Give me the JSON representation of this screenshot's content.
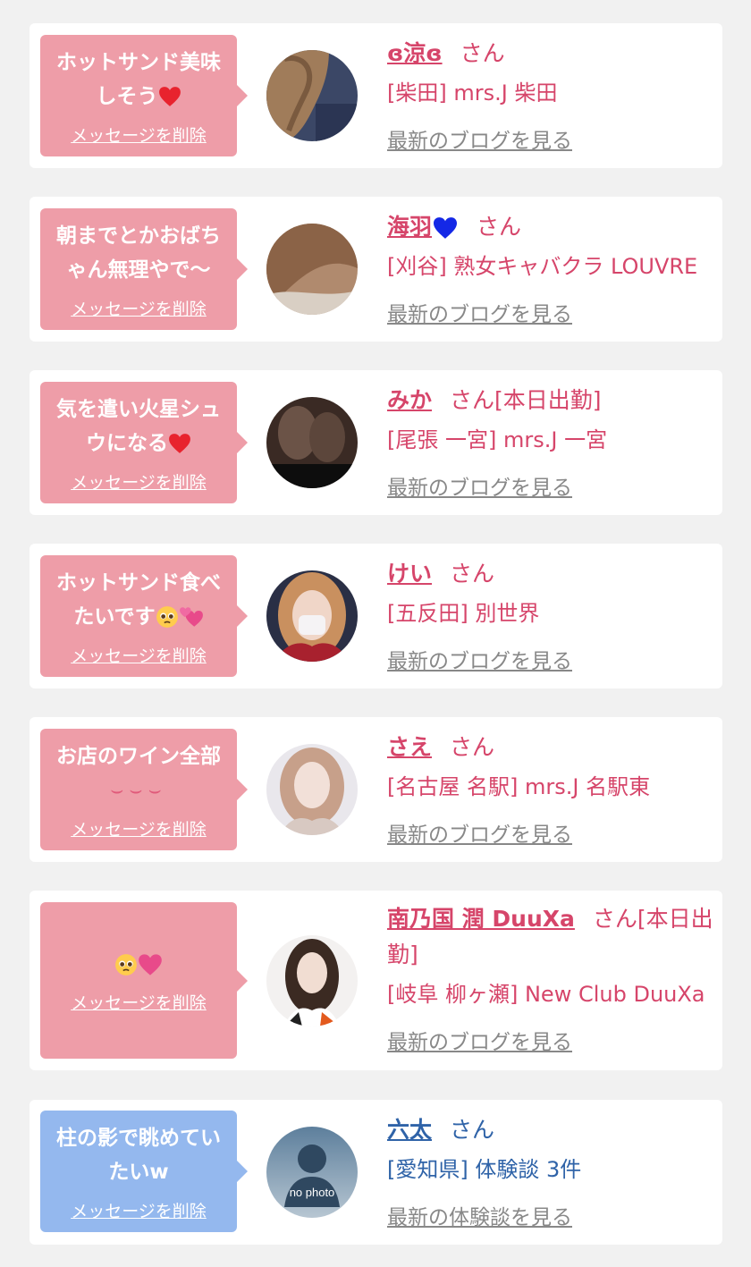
{
  "colors": {
    "pink_bubble": "#ee9da8",
    "blue_bubble": "#94b8ee",
    "pink_text": "#d6456a",
    "blue_text": "#2f63a8",
    "gray_link": "#888888"
  },
  "items": [
    {
      "message": "ホットサンド美味しそう",
      "message_icons": [
        "red-heart-icon"
      ],
      "delete": "メッセージを削除",
      "name": "ɞ涼ɞ",
      "san": "さん",
      "shop": "[柴田] mrs.J 柴田",
      "link": "最新のブログを見る"
    },
    {
      "message": "朝までとかおばちゃん無理やで〜",
      "message_icons": [],
      "delete": "メッセージを削除",
      "name": "海羽",
      "name_icons": [
        "blue-heart-icon"
      ],
      "san": "さん",
      "shop": "[刈谷] 熟女キャバクラ LOUVRE",
      "link": "最新のブログを見る"
    },
    {
      "message": "気を遣い火星シュウになる",
      "message_icons": [
        "red-heart-icon"
      ],
      "delete": "メッセージを削除",
      "name": "みか",
      "san": "さん[本日出勤]",
      "shop": "[尾張 一宮] mrs.J 一宮",
      "link": "最新のブログを見る"
    },
    {
      "message": "ホットサンド食べたいです",
      "message_icons": [
        "pleading-face-icon",
        "two-hearts-icon"
      ],
      "delete": "メッセージを削除",
      "name": "けい",
      "san": "さん",
      "shop": "[五反田] 別世界",
      "link": "最新のブログを見る"
    },
    {
      "message": "お店のワイン全部",
      "message_icons": [
        "weary-face-icon",
        "weary-face-icon",
        "weary-face-icon"
      ],
      "delete": "メッセージを削除",
      "name": "さえ",
      "san": "さん",
      "shop": "[名古屋 名駅] mrs.J 名駅東",
      "link": "最新のブログを見る"
    },
    {
      "message": "",
      "message_icons": [
        "pleading-face-icon",
        "pink-heart-icon"
      ],
      "delete": "メッセージを削除",
      "name": "南乃国 潤 DuuXa",
      "san": "さん[本日出勤]",
      "shop": "[岐阜 柳ヶ瀬] New Club DuuXa",
      "link": "最新のブログを見る"
    },
    {
      "message": "柱の影で眺めていたいw",
      "message_icons": [],
      "delete": "メッセージを削除",
      "name": "六太",
      "san": "さん",
      "shop": "[愛知県] 体験談 3件",
      "link": "最新の体験談を見る",
      "avatar_caption": "no photo"
    }
  ]
}
